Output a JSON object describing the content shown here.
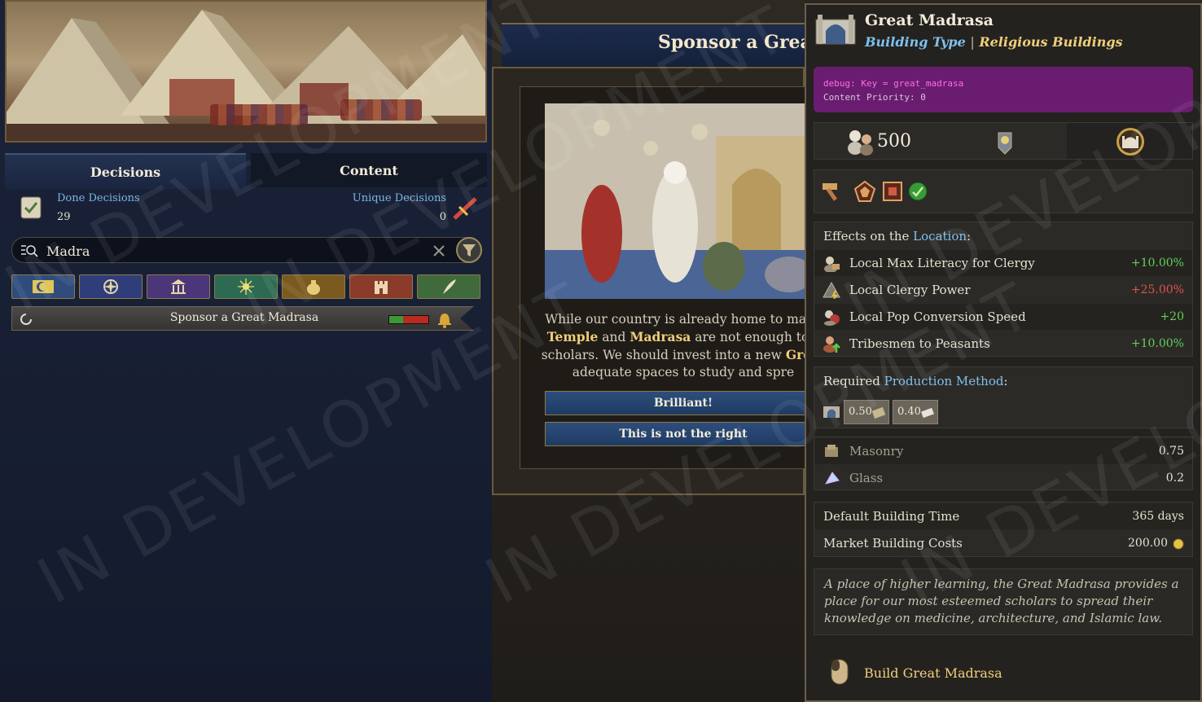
{
  "left": {
    "tabs": [
      "Decisions",
      "Content"
    ],
    "done_decisions": {
      "label": "Done Decisions",
      "value": "29"
    },
    "unique_decisions": {
      "label": "Unique Decisions",
      "value": "0"
    },
    "search": {
      "value": "Madra"
    },
    "filter_icons": [
      "crescent-icon",
      "compass-icon",
      "temple-icon",
      "sparkle-icon",
      "money-bag-icon",
      "castle-icon",
      "quill-icon"
    ],
    "decision": {
      "title": "Sponsor a Great Madrasa",
      "progress_fraction": 0.35
    }
  },
  "middle": {
    "title": "Sponsor a Great",
    "text_lines": [
      [
        "While our country is already home to many"
      ],
      [
        "Temple",
        " and ",
        "Madrasa",
        " are not enough to s"
      ],
      [
        "scholars. We should invest into a new ",
        "Great"
      ],
      [
        "adequate spaces to study and spre"
      ]
    ],
    "btn_accept": "Brilliant!",
    "btn_decline": "This is not the right"
  },
  "tooltip": {
    "title": "Great Madrasa",
    "sub_type": "Building Type",
    "sub_sep": "|",
    "sub_category": "Religious Buildings",
    "debug_key": "debug: Key = great_madrasa",
    "debug_priority": "Content Priority: 0",
    "pop_value": "500",
    "effects_prefix": "Effects on the ",
    "effects_link": "Location",
    "effects_suffix": ":",
    "effects": [
      {
        "label": "Local Max Literacy for Clergy",
        "value": "+10.00%",
        "color": "#5fd15a"
      },
      {
        "label": "Local Clergy Power",
        "value": "+25.00%",
        "color": "#e0524a"
      },
      {
        "label": "Local Pop Conversion Speed",
        "value": "+20",
        "color": "#5fd15a"
      },
      {
        "label": "Tribesmen to Peasants",
        "value": "+10.00%",
        "color": "#5fd15a"
      }
    ],
    "req_prefix": "Required ",
    "req_link": "Production Method",
    "req_suffix": ":",
    "pm_values": [
      "0.50",
      "0.40"
    ],
    "inputs": [
      {
        "label": "Masonry",
        "value": "0.75"
      },
      {
        "label": "Glass",
        "value": "0.2"
      }
    ],
    "build_time_label": "Default Building Time",
    "build_time_value": "365 days",
    "market_cost_label": "Market Building Costs",
    "market_cost_value": "200.00",
    "description": "A place of higher learning, the Great Madrasa provides a place for our most esteemed scholars to spread their knowledge on medicine, architecture, and Islamic law.",
    "build_action": "Build Great Madrasa"
  },
  "watermark": "IN DEVELOPMENT",
  "colors": {
    "link": "#7ec1ee",
    "gold": "#f0cf7a",
    "positive": "#5fd15a",
    "negative": "#e0524a"
  }
}
